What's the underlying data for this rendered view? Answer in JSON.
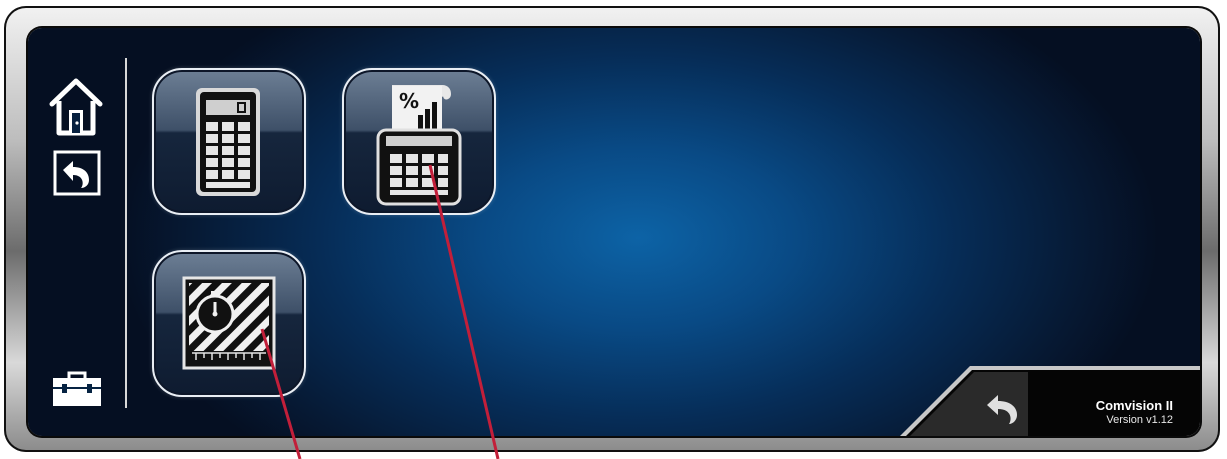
{
  "app": {
    "title": "Comvision II",
    "version": "Version v1.12"
  },
  "sidebar": {
    "home_icon": "home-icon",
    "back_icon": "back-arrow-icon",
    "tools_icon": "toolbox-icon"
  },
  "tiles": [
    {
      "icon": "calculator-icon"
    },
    {
      "icon": "percent-calculator-printer-icon"
    },
    {
      "icon": "timer-grid-icon"
    }
  ],
  "footer": {
    "back_icon": "back-arrow-icon"
  },
  "colors": {
    "accent_line": "#c21f3a",
    "screen_center": "#0d63a6",
    "screen_edge": "#050f22"
  }
}
